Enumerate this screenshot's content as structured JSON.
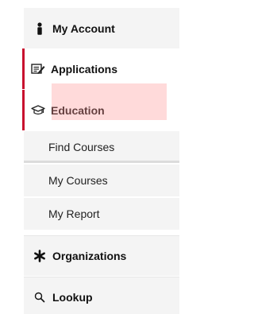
{
  "menu": {
    "my_account": {
      "label": "My Account",
      "icon": "person-icon"
    },
    "applications": {
      "label": "Applications",
      "icon": "edit-form-icon"
    },
    "education": {
      "label": "Education",
      "icon": "graduation-cap-icon"
    },
    "education_sub": [
      {
        "label": "Find Courses"
      },
      {
        "label": "My Courses"
      },
      {
        "label": "My Report"
      }
    ],
    "organizations": {
      "label": "Organizations",
      "icon": "asterisk-icon"
    },
    "lookup": {
      "label": "Lookup",
      "icon": "search-icon"
    }
  },
  "colors": {
    "accent": "#c8102e",
    "menu_bg": "#f4f4f4",
    "selected_bg": "#ffffff",
    "highlight_overlay": "#ff9696"
  }
}
